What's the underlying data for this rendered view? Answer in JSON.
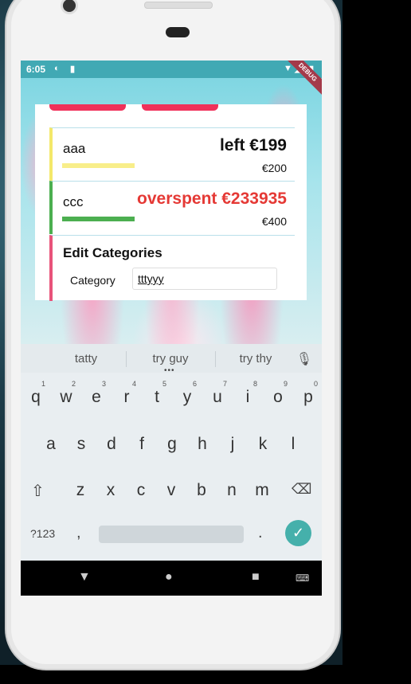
{
  "status_bar": {
    "time": "6:05",
    "debug_label": "DEBUG"
  },
  "categories": [
    {
      "name": "aaa",
      "status": "left €199",
      "budget": "€200",
      "overspent": false
    },
    {
      "name": "ccc",
      "status": "overspent €233935",
      "budget": "€400",
      "overspent": true
    }
  ],
  "edit": {
    "title": "Edit Categories",
    "category_label": "Category",
    "category_value": "tttyyy"
  },
  "keyboard": {
    "suggestions": [
      "tatty",
      "try guy",
      "try thy"
    ],
    "row1": [
      "q",
      "w",
      "e",
      "r",
      "t",
      "y",
      "u",
      "i",
      "o",
      "p"
    ],
    "row1_numbers": [
      "1",
      "2",
      "3",
      "4",
      "5",
      "6",
      "7",
      "8",
      "9",
      "0"
    ],
    "row2": [
      "a",
      "s",
      "d",
      "f",
      "g",
      "h",
      "j",
      "k",
      "l"
    ],
    "row3": [
      "z",
      "x",
      "c",
      "v",
      "b",
      "n",
      "m"
    ],
    "symbols_label": "?123",
    "comma": ",",
    "period": "."
  },
  "icons": {
    "mic": "mic-icon",
    "shift": "shift-icon",
    "backspace": "backspace-icon",
    "enter": "check-icon",
    "back": "back-icon",
    "home": "home-icon",
    "recents": "recents-icon",
    "keyboard": "keyboard-icon"
  },
  "colors": {
    "accent_red": "#f0315a",
    "overspent": "#e53935",
    "progress_green": "#4caf50",
    "progress_yellow": "#f8ee8a",
    "enter_key": "#45b0ab"
  }
}
